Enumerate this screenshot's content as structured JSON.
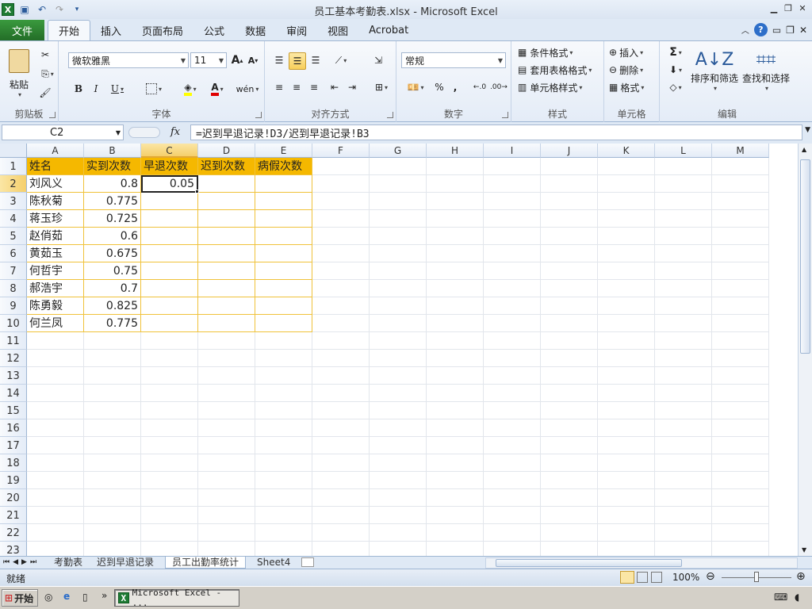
{
  "window": {
    "title": "员工基本考勤表.xlsx - Microsoft Excel"
  },
  "ribbon_tabs": [
    "开始",
    "插入",
    "页面布局",
    "公式",
    "数据",
    "审阅",
    "视图",
    "Acrobat"
  ],
  "file_tab": "文件",
  "clipboard": {
    "paste": "粘贴",
    "label": "剪贴板"
  },
  "font": {
    "name": "微软雅黑",
    "size": "11",
    "label": "字体"
  },
  "alignment": {
    "label": "对齐方式"
  },
  "number": {
    "format": "常规",
    "label": "数字"
  },
  "styles": {
    "conditional": "条件格式",
    "table": "套用表格格式",
    "cell": "单元格样式",
    "label": "样式"
  },
  "cells_group": {
    "insert": "插入",
    "delete": "删除",
    "format": "格式",
    "label": "单元格"
  },
  "editing": {
    "sort": "排序和筛选",
    "find": "查找和选择",
    "label": "编辑"
  },
  "formula_bar": {
    "name_box": "C2",
    "fx": "fx",
    "formula": "=迟到早退记录!D3/迟到早退记录!B3"
  },
  "columns": [
    "A",
    "B",
    "C",
    "D",
    "E",
    "F",
    "G",
    "H",
    "I",
    "J",
    "K",
    "L",
    "M"
  ],
  "rows": [
    "1",
    "2",
    "3",
    "4",
    "5",
    "6",
    "7",
    "8",
    "9",
    "10",
    "11",
    "12",
    "13",
    "14",
    "15",
    "16",
    "17",
    "18",
    "19",
    "20",
    "21",
    "22",
    "23"
  ],
  "table": {
    "headers": [
      "姓名",
      "实到次数",
      "早退次数",
      "迟到次数",
      "病假次数"
    ],
    "names": [
      "刘风义",
      "陈秋菊",
      "蒋玉珍",
      "赵俏茹",
      "黄茹玉",
      "何哲宇",
      "郝浩宇",
      "陈勇毅",
      "何兰凤"
    ],
    "actual": [
      "0.8",
      "0.775",
      "0.725",
      "0.6",
      "0.675",
      "0.75",
      "0.7",
      "0.825",
      "0.775"
    ],
    "early_c2": "0.05"
  },
  "sheets": [
    "考勤表",
    "迟到早退记录",
    "员工出勤率统计",
    "Sheet4"
  ],
  "active_sheet": "员工出勤率统计",
  "status": {
    "ready": "就绪",
    "zoom": "100%"
  },
  "taskbar": {
    "start": "开始",
    "app": "Microsoft Excel - ..."
  },
  "colors": {
    "header_fill": "#f5b800",
    "file_tab": "#2f7d32",
    "accent": "#2e6fc9"
  }
}
